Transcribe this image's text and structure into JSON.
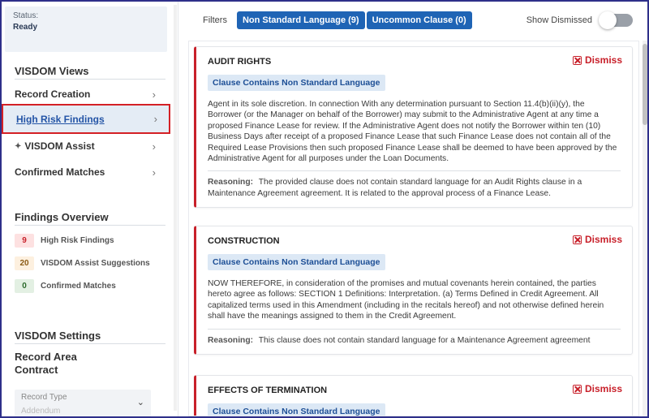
{
  "sidebar": {
    "status_label": "Status:",
    "status_value": "Ready",
    "views_title": "VISDOM Views",
    "nav": [
      {
        "label": "Record Creation"
      },
      {
        "label": "High Risk Findings"
      },
      {
        "label": "VISDOM Assist"
      },
      {
        "label": "Confirmed Matches"
      }
    ],
    "findings_title": "Findings Overview",
    "findings": [
      {
        "count": "9",
        "label": "High Risk Findings",
        "bg": "#fde1e1",
        "fg": "#c8202a"
      },
      {
        "count": "20",
        "label": "VISDOM Assist Suggestions",
        "bg": "#fdf0df",
        "fg": "#8a5a14"
      },
      {
        "count": "0",
        "label": "Confirmed Matches",
        "bg": "#e3f0e3",
        "fg": "#2b6a2b"
      }
    ],
    "settings_title": "VISDOM Settings",
    "record_area_title": "Record Area Contract",
    "record_type_label": "Record Type",
    "record_type_value": "Addendum"
  },
  "filters": {
    "label": "Filters",
    "chips": [
      "Non Standard Language (9)",
      "Uncommon Clause (0)"
    ],
    "show_dismissed_label": "Show Dismissed",
    "show_dismissed_on": false
  },
  "cards": [
    {
      "title": "AUDIT RIGHTS",
      "dismiss": "Dismiss",
      "tag": "Clause Contains Non Standard Language",
      "clause": "Agent in its sole discretion. In connection With any determination pursuant to Section 11.4(b)(ii)(y), the Borrower (or the Manager on behalf of the Borrower) may submit to the Administrative Agent at any time a proposed Finance Lease for review. If the Administrative Agent does not notify the Borrower within ten (10) Business Days after receipt of a proposed Finance Lease that such Finance Lease does not contain all of the Required Lease Provisions then such proposed Finance Lease shall be deemed to have been approved by the Administrative Agent for all purposes under the Loan Documents.",
      "reasoning_label": "Reasoning:",
      "reasoning": "The provided clause does not contain standard language for an Audit Rights clause in a Maintenance Agreement agreement. It is related to the approval process of a Finance Lease."
    },
    {
      "title": "CONSTRUCTION",
      "dismiss": "Dismiss",
      "tag": "Clause Contains Non Standard Language",
      "clause": "NOW THEREFORE, in consideration of the promises and mutual covenants herein contained, the parties hereto agree as follows: SECTION 1 Definitions: Interpretation. (a) Terms Defined in Credit Agreement. All capitalized terms used in this Amendment (including in the recitals hereof) and not otherwise defined herein shall have the meanings assigned to them in the Credit Agreement.",
      "reasoning_label": "Reasoning:",
      "reasoning": "This clause does not contain standard language for a Maintenance Agreement agreement"
    },
    {
      "title": "EFFECTS OF TERMINATION",
      "dismiss": "Dismiss",
      "tag": "Clause Contains Non Standard Language",
      "clause": "",
      "reasoning_label": "",
      "reasoning": ""
    }
  ],
  "colors": {
    "accent": "#1f64b5",
    "danger": "#c8202a",
    "frame": "#2e2f8a"
  }
}
